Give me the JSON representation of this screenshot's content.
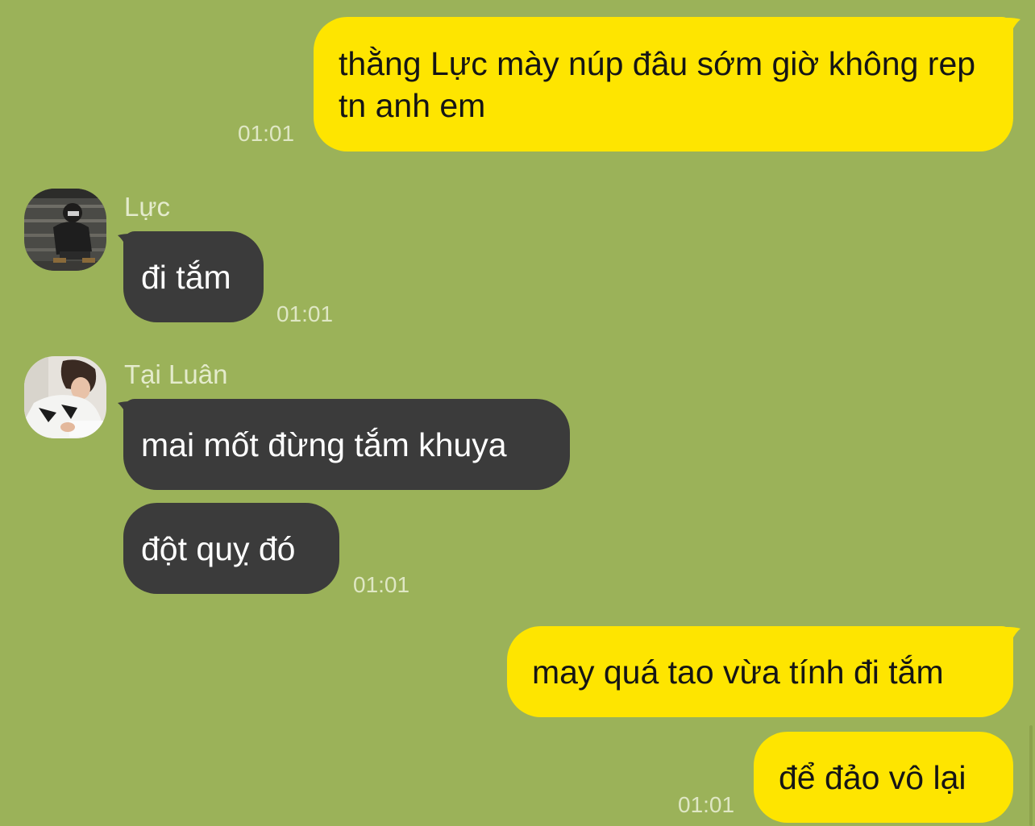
{
  "colors": {
    "background": "#9bb259",
    "outgoing_bubble": "#fee500",
    "incoming_bubble": "#3b3b3b",
    "timestamp": "#dfe7c4"
  },
  "messages": [
    {
      "direction": "out",
      "text": "thằng Lực mày núp đâu sớm giờ không rep tn anh em",
      "time": "01:01"
    },
    {
      "direction": "in",
      "sender": "Lực",
      "text": "đi tắm",
      "time": "01:01"
    },
    {
      "direction": "in",
      "sender": "Tại Luân",
      "text": "mai mốt đừng tắm khuya"
    },
    {
      "direction": "in",
      "sender": "Tại Luân",
      "text": "đột quỵ đó",
      "time": "01:01"
    },
    {
      "direction": "out",
      "text": "may quá tao vừa tính đi tắm"
    },
    {
      "direction": "out",
      "text": "để đảo vô lại",
      "time": "01:01"
    }
  ],
  "avatars": [
    {
      "icon": "person-crouching-avatar",
      "sender": "Lực"
    },
    {
      "icon": "person-writing-avatar",
      "sender": "Tại Luân"
    }
  ]
}
